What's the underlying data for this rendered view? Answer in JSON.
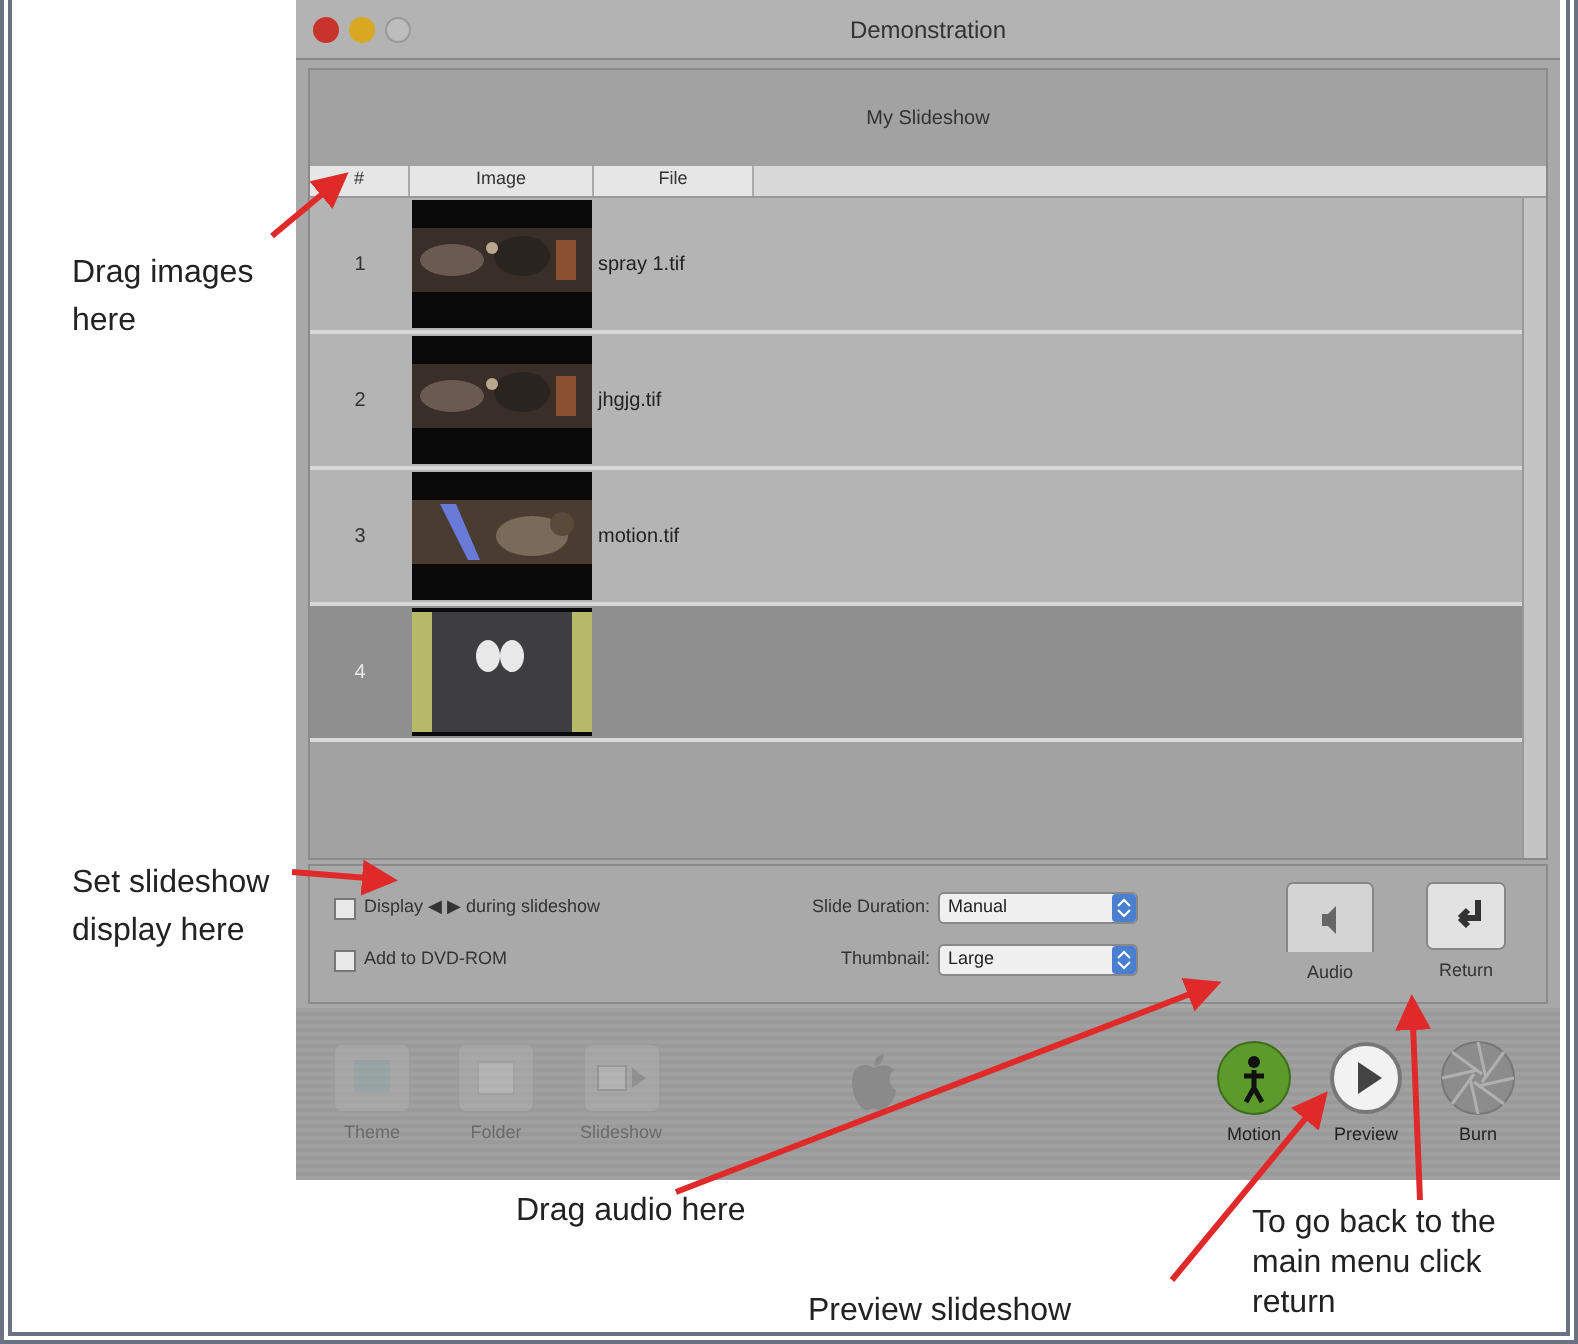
{
  "window": {
    "title": "Demonstration"
  },
  "slideshow": {
    "title": "My Slideshow",
    "columns": [
      "#",
      "Image",
      "File"
    ],
    "rows": [
      {
        "number": "1",
        "file": "spray 1.tif",
        "selected": false,
        "kind": "dark"
      },
      {
        "number": "2",
        "file": "jhgjg.tif",
        "selected": false,
        "kind": "dark"
      },
      {
        "number": "3",
        "file": "motion.tif",
        "selected": false,
        "kind": "blue"
      },
      {
        "number": "4",
        "selected": true,
        "kind": "shirt"
      }
    ]
  },
  "options": {
    "checkboxes": [
      {
        "label": "Display ◀ ▶ during slideshow",
        "checked": false
      },
      {
        "label": "Add to DVD-ROM",
        "checked": false
      }
    ],
    "selects": [
      {
        "label": "Slide Duration:",
        "value": "Manual"
      },
      {
        "label": "Thumbnail:",
        "value": "Large"
      }
    ]
  },
  "side_buttons": [
    {
      "kind": "audio",
      "label": "Audio"
    },
    {
      "kind": "return",
      "label": "Return"
    }
  ],
  "toolbar": [
    {
      "kind": "theme",
      "label": "Theme",
      "disabled": true
    },
    {
      "kind": "folder",
      "label": "Folder",
      "disabled": true
    },
    {
      "kind": "slideshow",
      "label": "Slideshow",
      "disabled": true
    },
    {
      "kind": "motion",
      "label": "Motion",
      "disabled": false
    },
    {
      "kind": "preview",
      "label": "Preview",
      "disabled": false
    },
    {
      "kind": "burn",
      "label": "Burn",
      "disabled": false
    }
  ],
  "annotations": [
    {
      "text": "Drag images here"
    },
    {
      "text": "Set slideshow display here"
    },
    {
      "text": "Drag audio here"
    },
    {
      "text": "Preview slideshow"
    },
    {
      "text": "To go back to the main menu click return"
    }
  ]
}
